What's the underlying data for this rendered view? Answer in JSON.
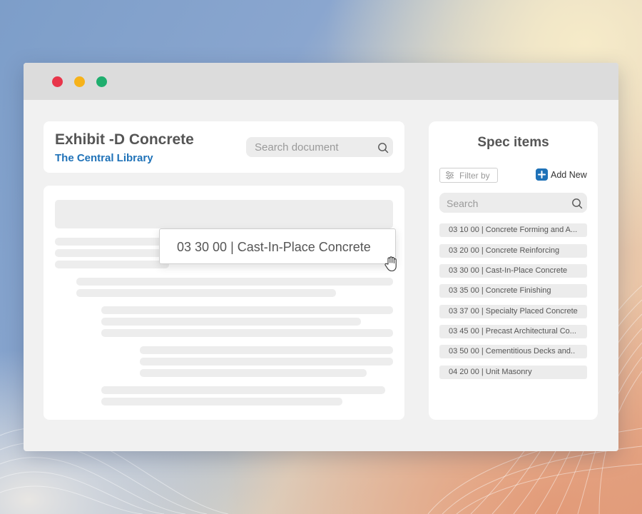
{
  "document": {
    "title": "Exhibit -D Concrete",
    "project": "The Central Library",
    "search_placeholder": "Search document"
  },
  "tooltip": {
    "text": "03 30 00 | Cast-In-Place Concrete"
  },
  "spec_panel": {
    "title": "Spec items",
    "filter_label": "Filter by",
    "add_new_label": "Add New",
    "search_placeholder": "Search",
    "items": [
      {
        "label": "03 10 00 | Concrete Forming and A..."
      },
      {
        "label": "03 20 00 | Concrete Reinforcing"
      },
      {
        "label": "03 30 00 | Cast-In-Place Concrete"
      },
      {
        "label": "03 35 00 | Concrete Finishing"
      },
      {
        "label": "03 37 00 | Specialty Placed Concrete"
      },
      {
        "label": "03 45 00 | Precast Architectural Co..."
      },
      {
        "label": "03 50 00 | Cementitious Decks and.."
      },
      {
        "label": "04 20 00 | Unit Masonry"
      }
    ]
  },
  "colors": {
    "accent": "#1f72b8",
    "traffic_red": "#e8354a",
    "traffic_yellow": "#f6b21a",
    "traffic_green": "#1fae6e"
  },
  "icons": {
    "window_controls": [
      "close-dot",
      "minimize-dot",
      "maximize-dot"
    ],
    "search": "search-icon",
    "filter": "sliders-icon",
    "add": "plus-icon",
    "cursor": "hand-pointer-icon"
  }
}
